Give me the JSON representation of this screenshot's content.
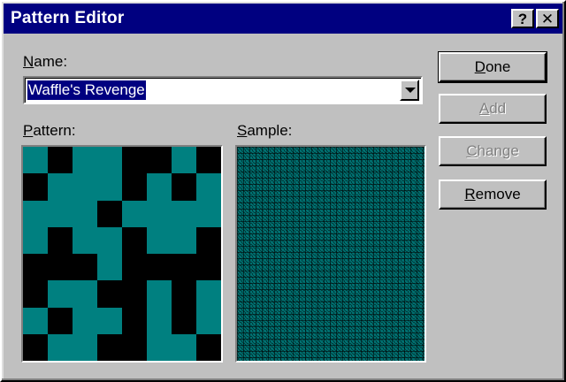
{
  "window": {
    "title": "Pattern Editor",
    "help_label": "?",
    "close_label": "✕"
  },
  "name_field": {
    "label_access_key": "N",
    "label_rest": "ame:",
    "value": "Waffle's Revenge"
  },
  "pattern": {
    "label_access_key": "P",
    "label_rest": "attern:",
    "rows": [
      [
        1,
        0,
        1,
        1,
        0,
        0,
        1,
        0
      ],
      [
        0,
        1,
        1,
        1,
        0,
        1,
        0,
        1
      ],
      [
        1,
        1,
        1,
        0,
        1,
        1,
        1,
        1
      ],
      [
        1,
        0,
        1,
        1,
        0,
        1,
        1,
        0
      ],
      [
        0,
        0,
        0,
        1,
        0,
        0,
        0,
        0
      ],
      [
        0,
        1,
        1,
        0,
        0,
        1,
        0,
        1
      ],
      [
        1,
        0,
        1,
        1,
        0,
        1,
        0,
        1
      ],
      [
        0,
        1,
        1,
        0,
        0,
        1,
        1,
        0
      ]
    ],
    "on_color": "#008080",
    "off_color": "#000000"
  },
  "sample": {
    "label_access_key": "S",
    "label_rest": "ample:"
  },
  "buttons": {
    "done": {
      "access_key": "D",
      "rest": "one"
    },
    "add": {
      "access_key": "A",
      "rest": "dd"
    },
    "change": {
      "access_key": "C",
      "rest": "hange"
    },
    "remove": {
      "access_key": "R",
      "rest": "emove"
    }
  }
}
